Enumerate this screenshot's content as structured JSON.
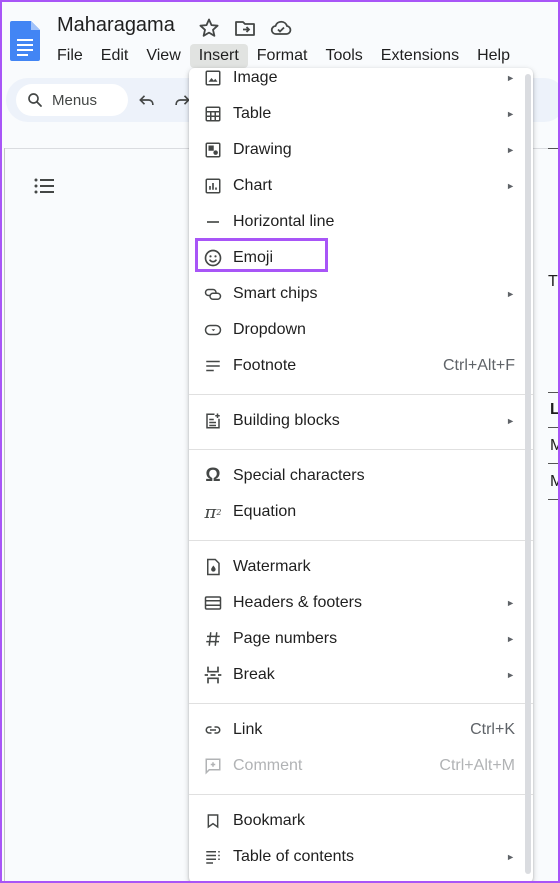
{
  "app": {
    "doc_title": "Maharagama",
    "accent_color": "#4285f4",
    "highlight_color": "#a855f7"
  },
  "menubar": [
    "File",
    "Edit",
    "View",
    "Insert",
    "Format",
    "Tools",
    "Extensions",
    "Help"
  ],
  "menubar_active": "Insert",
  "toolbar": {
    "search_label": "Menus"
  },
  "insert_menu": {
    "groups": [
      [
        {
          "label": "Image",
          "icon": "image-icon",
          "submenu": true
        },
        {
          "label": "Table",
          "icon": "table-icon",
          "submenu": true
        },
        {
          "label": "Drawing",
          "icon": "drawing-icon",
          "submenu": true
        },
        {
          "label": "Chart",
          "icon": "chart-icon",
          "submenu": true
        },
        {
          "label": "Horizontal line",
          "icon": "horizontal-line-icon"
        },
        {
          "label": "Emoji",
          "icon": "emoji-icon",
          "highlighted": true
        },
        {
          "label": "Smart chips",
          "icon": "smart-chips-icon",
          "submenu": true
        },
        {
          "label": "Dropdown",
          "icon": "dropdown-icon"
        },
        {
          "label": "Footnote",
          "icon": "footnote-icon",
          "shortcut": "Ctrl+Alt+F"
        }
      ],
      [
        {
          "label": "Building blocks",
          "icon": "building-blocks-icon",
          "submenu": true
        }
      ],
      [
        {
          "label": "Special characters",
          "icon": "omega-icon"
        },
        {
          "label": "Equation",
          "icon": "pi-icon"
        }
      ],
      [
        {
          "label": "Watermark",
          "icon": "watermark-icon"
        },
        {
          "label": "Headers & footers",
          "icon": "headers-footers-icon",
          "submenu": true
        },
        {
          "label": "Page numbers",
          "icon": "hash-icon",
          "submenu": true
        },
        {
          "label": "Break",
          "icon": "break-icon",
          "submenu": true
        }
      ],
      [
        {
          "label": "Link",
          "icon": "link-icon",
          "shortcut": "Ctrl+K"
        },
        {
          "label": "Comment",
          "icon": "comment-icon",
          "shortcut": "Ctrl+Alt+M",
          "disabled": true
        }
      ],
      [
        {
          "label": "Bookmark",
          "icon": "bookmark-icon"
        },
        {
          "label": "Table of contents",
          "icon": "table-of-contents-icon",
          "submenu": true
        }
      ]
    ]
  },
  "document_edge_text": [
    "Th",
    "L",
    "M",
    "M"
  ]
}
